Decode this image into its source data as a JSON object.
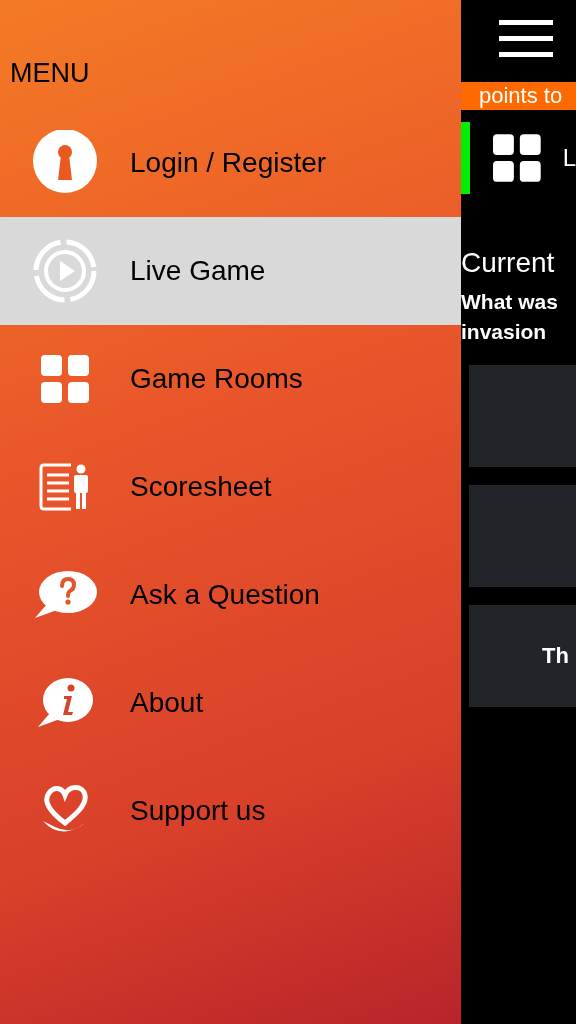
{
  "menu": {
    "title": "MENU",
    "items": [
      {
        "kind": "login",
        "label": "Login / Register",
        "selected": false
      },
      {
        "kind": "live",
        "label": "Live Game",
        "selected": true
      },
      {
        "kind": "rooms",
        "label": "Game Rooms",
        "selected": false
      },
      {
        "kind": "scoresheet",
        "label": "Scoresheet",
        "selected": false
      },
      {
        "kind": "question",
        "label": "Ask a Question",
        "selected": false
      },
      {
        "kind": "about",
        "label": "About",
        "selected": false
      },
      {
        "kind": "support",
        "label": "Support us",
        "selected": false
      }
    ]
  },
  "background_screen": {
    "banner": "points to",
    "room_label": "L",
    "heading": "Current",
    "question": "What was invasion",
    "answers": [
      {
        "kind": "blank"
      },
      {
        "kind": "blank"
      },
      {
        "kind": "labeled",
        "text": "Th"
      }
    ]
  }
}
